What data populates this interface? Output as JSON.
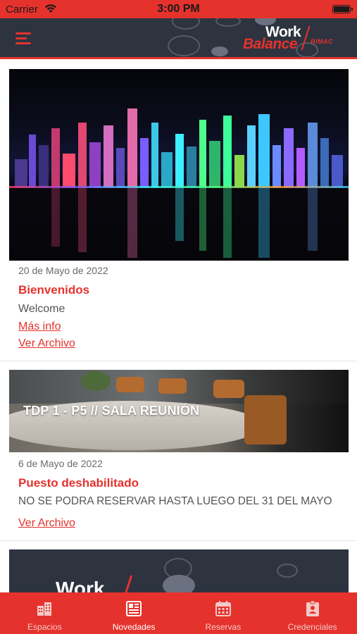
{
  "status_bar": {
    "carrier": "Carrier",
    "time": "3:00 PM"
  },
  "header": {
    "logo_line1": "Work",
    "logo_line2": "Balance",
    "logo_brand": "RIMAC"
  },
  "posts": [
    {
      "date": "20 de Mayo de 2022",
      "title": "Bienvenidos",
      "description": "Welcome",
      "links": [
        "Más info",
        "Ver Archivo"
      ]
    },
    {
      "image_caption": "TDP 1 - P5 // SALA REUNIÓN",
      "date": "6 de Mayo de 2022",
      "title": "Puesto deshabilitado",
      "description": "NO SE PODRA RESERVAR HASTA LUEGO DEL 31 DEL MAYO",
      "links": [
        "Ver Archivo"
      ]
    },
    {
      "banner_text": "Work"
    }
  ],
  "tabs": [
    {
      "label": "Espacios",
      "icon": "buildings-icon",
      "active": false
    },
    {
      "label": "Novedades",
      "icon": "newspaper-icon",
      "active": true
    },
    {
      "label": "Reservas",
      "icon": "calendar-icon",
      "active": false
    },
    {
      "label": "Credenciales",
      "icon": "badge-icon",
      "active": false
    }
  ],
  "colors": {
    "brand_red": "#e5322d",
    "header_dark": "#2e3340"
  }
}
